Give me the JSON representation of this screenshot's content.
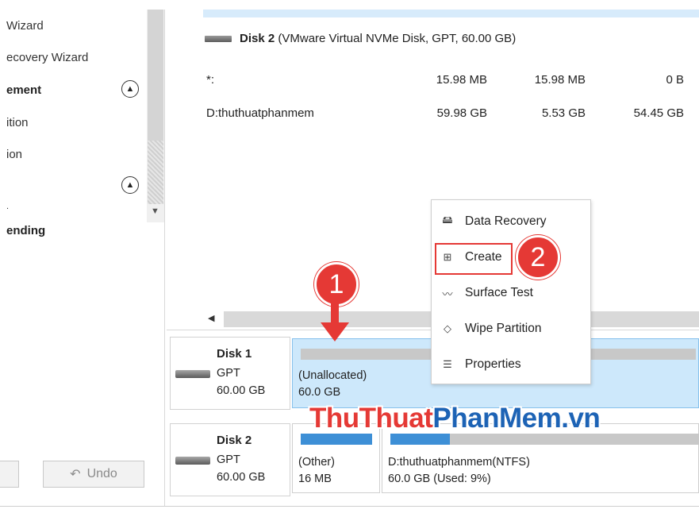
{
  "sidebar": {
    "items": [
      {
        "label": "Wizard"
      },
      {
        "label": "ecovery Wizard"
      },
      {
        "label": "ement"
      },
      {
        "label": "ition"
      },
      {
        "label": "ion"
      },
      {
        "label": "."
      },
      {
        "label": "ending"
      }
    ],
    "undo_label": "Undo",
    "undo_glyph": "↶"
  },
  "disk_list": {
    "disk2_name": "Disk 2",
    "disk2_desc": "(VMware Virtual NVMe Disk, GPT, 60.00 GB)",
    "rows": [
      {
        "name": "*:",
        "capacity": "15.98 MB",
        "used": "15.98 MB",
        "unused": "0 B"
      },
      {
        "name": "D:thuthuatphanmem",
        "capacity": "59.98 GB",
        "used": "5.53 GB",
        "unused": "54.45 GB"
      }
    ]
  },
  "context_menu": {
    "items": [
      {
        "label": "Data Recovery",
        "icon": "hdd-icon"
      },
      {
        "label": "Create",
        "icon": "plus-box-icon"
      },
      {
        "label": "Surface Test",
        "icon": "waveform-icon"
      },
      {
        "label": "Wipe Partition",
        "icon": "eraser-icon"
      },
      {
        "label": "Properties",
        "icon": "list-icon"
      }
    ]
  },
  "callouts": {
    "step1": "1",
    "step2": "2"
  },
  "disk_map": {
    "disk1": {
      "name": "Disk 1",
      "style": "GPT",
      "size": "60.00 GB",
      "partitions": [
        {
          "label": "(Unallocated)",
          "size": "60.0 GB",
          "usage": 0
        }
      ]
    },
    "disk2": {
      "name": "Disk 2",
      "style": "GPT",
      "size": "60.00 GB",
      "partitions": [
        {
          "label": "(Other)",
          "size": "16 MB",
          "usage": 1.0
        },
        {
          "label": "D:thuthuatphanmem(NTFS)",
          "size": "60.0 GB (Used: 9%)",
          "usage": 0.09
        }
      ]
    }
  },
  "watermark": {
    "part1": "ThuThuat",
    "part2": "PhanMem",
    "part3": ".vn"
  },
  "colors": {
    "accent": "#e53935",
    "selection": "#cde8fb",
    "bar_fill": "#3d8fd6",
    "watermark_blue": "#1d63b5"
  }
}
